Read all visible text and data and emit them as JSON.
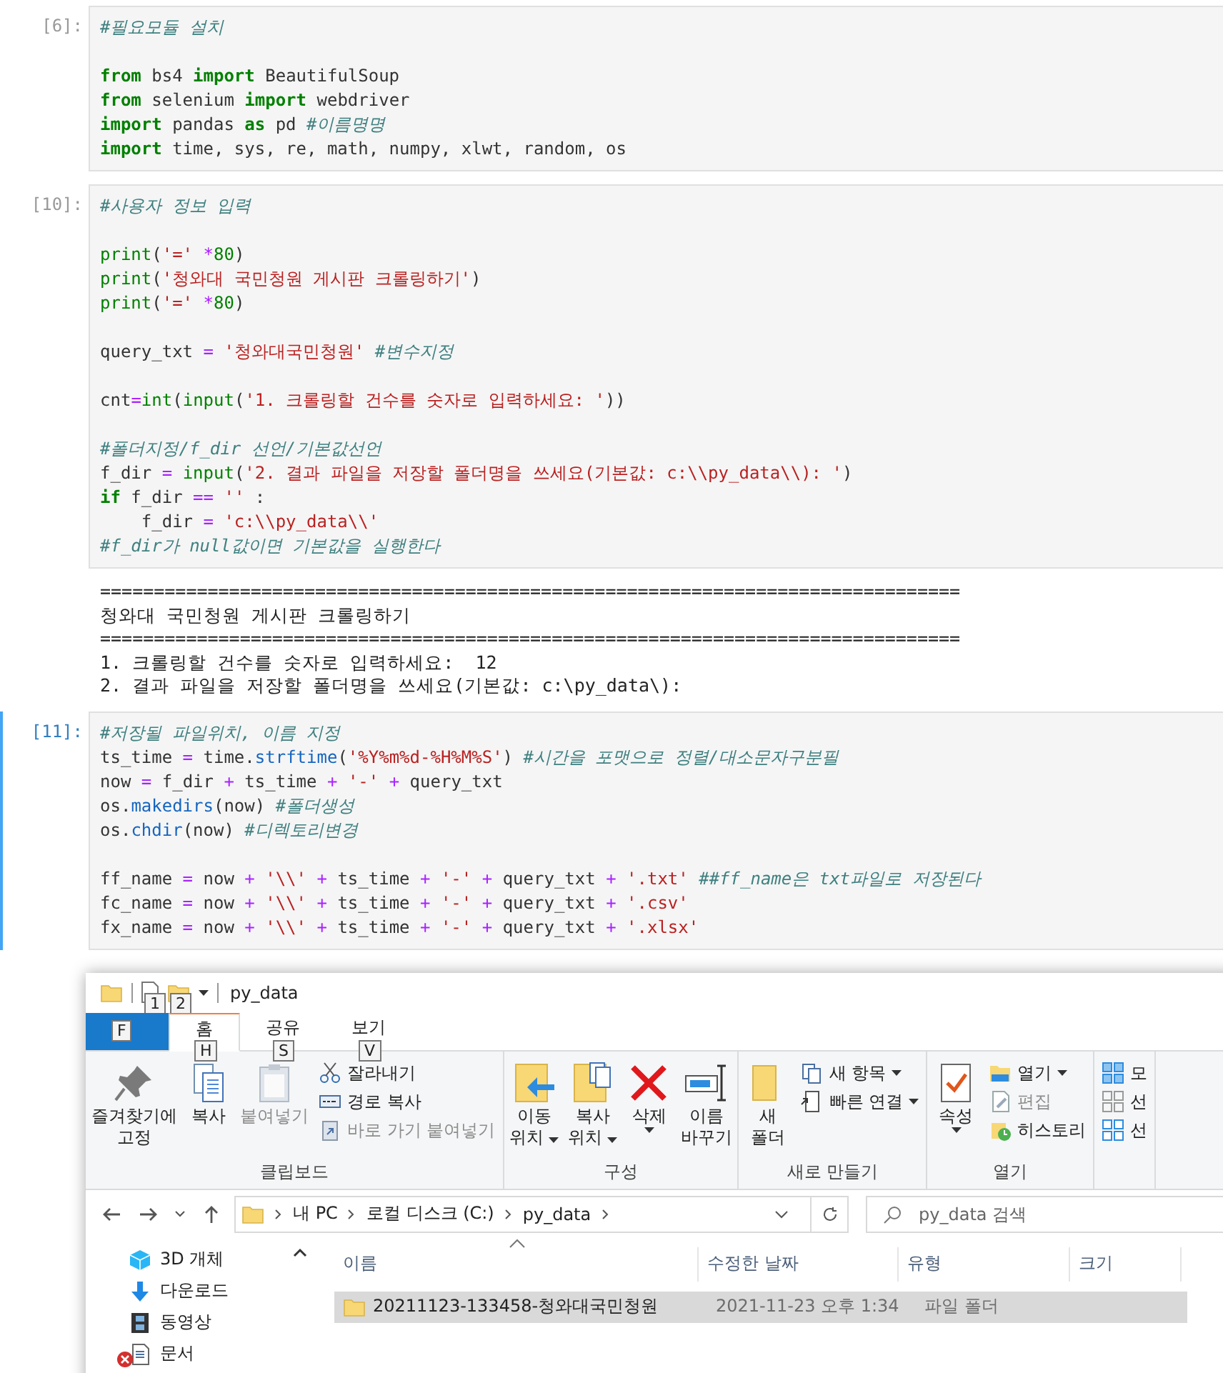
{
  "cells": [
    {
      "prompt": "[6]:",
      "active": false,
      "blocks": [
        [
          [
            {
              "kind": "comment",
              "text": "#필요모듈 설치"
            }
          ]
        ],
        [
          [
            {
              "kind": "keyword",
              "text": "from"
            },
            {
              "kind": "plain",
              "text": " bs4 "
            },
            {
              "kind": "keyword",
              "text": "import"
            },
            {
              "kind": "plain",
              "text": " BeautifulSoup"
            }
          ],
          [
            {
              "kind": "keyword",
              "text": "from"
            },
            {
              "kind": "plain",
              "text": " selenium "
            },
            {
              "kind": "keyword",
              "text": "import"
            },
            {
              "kind": "plain",
              "text": " webdriver"
            }
          ],
          [
            {
              "kind": "keyword",
              "text": "import"
            },
            {
              "kind": "plain",
              "text": " pandas "
            },
            {
              "kind": "keyword",
              "text": "as"
            },
            {
              "kind": "plain",
              "text": " pd "
            },
            {
              "kind": "comment",
              "text": "#이름명명"
            }
          ],
          [
            {
              "kind": "keyword",
              "text": "import"
            },
            {
              "kind": "plain",
              "text": " time, sys, re, math, numpy, xlwt, random, os"
            }
          ]
        ]
      ]
    },
    {
      "prompt": "[10]:",
      "active": false,
      "blocks": [
        [
          [
            {
              "kind": "comment",
              "text": "#사용자 정보 입력"
            }
          ]
        ],
        [
          [
            {
              "kind": "builtin",
              "text": "print"
            },
            {
              "kind": "plain",
              "text": "("
            },
            {
              "kind": "string",
              "text": "'=' "
            },
            {
              "kind": "operator",
              "text": "*"
            },
            {
              "kind": "number",
              "text": "80"
            },
            {
              "kind": "plain",
              "text": ")"
            }
          ],
          [
            {
              "kind": "builtin",
              "text": "print"
            },
            {
              "kind": "plain",
              "text": "("
            },
            {
              "kind": "string",
              "text": "'청와대 국민청원 게시판 크롤링하기'"
            },
            {
              "kind": "plain",
              "text": ")"
            }
          ],
          [
            {
              "kind": "builtin",
              "text": "print"
            },
            {
              "kind": "plain",
              "text": "("
            },
            {
              "kind": "string",
              "text": "'=' "
            },
            {
              "kind": "operator",
              "text": "*"
            },
            {
              "kind": "number",
              "text": "80"
            },
            {
              "kind": "plain",
              "text": ")"
            }
          ]
        ],
        [
          [
            {
              "kind": "plain",
              "text": "query_txt "
            },
            {
              "kind": "operator",
              "text": "= "
            },
            {
              "kind": "string",
              "text": "'청와대국민청원' "
            },
            {
              "kind": "comment",
              "text": "#변수지정"
            }
          ]
        ],
        [
          [
            {
              "kind": "plain",
              "text": "cnt"
            },
            {
              "kind": "operator",
              "text": "="
            },
            {
              "kind": "builtin",
              "text": "int"
            },
            {
              "kind": "plain",
              "text": "("
            },
            {
              "kind": "builtin",
              "text": "input"
            },
            {
              "kind": "plain",
              "text": "("
            },
            {
              "kind": "string",
              "text": "'1. 크롤링할 건수를 숫자로 입력하세요: '"
            },
            {
              "kind": "plain",
              "text": "))"
            }
          ]
        ],
        [
          [
            {
              "kind": "comment",
              "text": "#폴더지정/f_dir 선언/기본값선언"
            }
          ],
          [
            {
              "kind": "plain",
              "text": "f_dir "
            },
            {
              "kind": "operator",
              "text": "= "
            },
            {
              "kind": "builtin",
              "text": "input"
            },
            {
              "kind": "plain",
              "text": "("
            },
            {
              "kind": "string",
              "text": "'2. 결과 파일을 저장할 폴더명을 쓰세요(기본값: c:\\\\py_data\\\\): '"
            },
            {
              "kind": "plain",
              "text": ")"
            }
          ],
          [
            {
              "kind": "keyword",
              "text": "if"
            },
            {
              "kind": "plain",
              "text": " f_dir "
            },
            {
              "kind": "operator",
              "text": "== "
            },
            {
              "kind": "string",
              "text": "''"
            },
            {
              "kind": "plain",
              "text": " :"
            }
          ],
          [
            {
              "kind": "plain",
              "text": "    f_dir "
            },
            {
              "kind": "operator",
              "text": "= "
            },
            {
              "kind": "string",
              "text": "'c:\\\\py_data\\\\'"
            }
          ],
          [
            {
              "kind": "comment",
              "text": "#f_dir가 null값이면 기본값을 실행한다"
            }
          ]
        ]
      ],
      "output": [
        "================================================================================",
        "청와대 국민청원 게시판 크롤링하기",
        "================================================================================",
        "1. 크롤링할 건수를 숫자로 입력하세요:  12",
        "2. 결과 파일을 저장할 폴더명을 쓰세요(기본값: c:\\py_data\\):"
      ]
    },
    {
      "prompt": "[11]:",
      "active": true,
      "blocks": [
        [
          [
            {
              "kind": "comment",
              "text": "#저장될 파일위치, 이름 지정"
            }
          ],
          [
            {
              "kind": "plain",
              "text": "ts_time "
            },
            {
              "kind": "operator",
              "text": "="
            },
            {
              "kind": "plain",
              "text": " time."
            },
            {
              "kind": "method",
              "text": "strftime"
            },
            {
              "kind": "plain",
              "text": "("
            },
            {
              "kind": "string",
              "text": "'%Y%m%d-%H%M%S'"
            },
            {
              "kind": "plain",
              "text": ") "
            },
            {
              "kind": "comment",
              "text": "#시간을 포맷으로 정렬/대소문자구분필"
            }
          ],
          [
            {
              "kind": "plain",
              "text": "now "
            },
            {
              "kind": "operator",
              "text": "="
            },
            {
              "kind": "plain",
              "text": " f_dir "
            },
            {
              "kind": "operator",
              "text": "+"
            },
            {
              "kind": "plain",
              "text": " ts_time "
            },
            {
              "kind": "operator",
              "text": "+ "
            },
            {
              "kind": "string",
              "text": "'-' "
            },
            {
              "kind": "operator",
              "text": "+"
            },
            {
              "kind": "plain",
              "text": " query_txt"
            }
          ],
          [
            {
              "kind": "plain",
              "text": "os."
            },
            {
              "kind": "method",
              "text": "makedirs"
            },
            {
              "kind": "plain",
              "text": "(now) "
            },
            {
              "kind": "comment",
              "text": "#폴더생성"
            }
          ],
          [
            {
              "kind": "plain",
              "text": "os."
            },
            {
              "kind": "method",
              "text": "chdir"
            },
            {
              "kind": "plain",
              "text": "(now) "
            },
            {
              "kind": "comment",
              "text": "#디렉토리변경"
            }
          ]
        ],
        [
          [
            {
              "kind": "plain",
              "text": "ff_name "
            },
            {
              "kind": "operator",
              "text": "="
            },
            {
              "kind": "plain",
              "text": " now "
            },
            {
              "kind": "operator",
              "text": "+ "
            },
            {
              "kind": "string",
              "text": "'\\\\' "
            },
            {
              "kind": "operator",
              "text": "+"
            },
            {
              "kind": "plain",
              "text": " ts_time "
            },
            {
              "kind": "operator",
              "text": "+ "
            },
            {
              "kind": "string",
              "text": "'-' "
            },
            {
              "kind": "operator",
              "text": "+"
            },
            {
              "kind": "plain",
              "text": " query_txt "
            },
            {
              "kind": "operator",
              "text": "+ "
            },
            {
              "kind": "string",
              "text": "'.txt' "
            },
            {
              "kind": "comment",
              "text": "##ff_name은 txt파일로 저장된다"
            }
          ],
          [
            {
              "kind": "plain",
              "text": "fc_name "
            },
            {
              "kind": "operator",
              "text": "="
            },
            {
              "kind": "plain",
              "text": " now "
            },
            {
              "kind": "operator",
              "text": "+ "
            },
            {
              "kind": "string",
              "text": "'\\\\' "
            },
            {
              "kind": "operator",
              "text": "+"
            },
            {
              "kind": "plain",
              "text": " ts_time "
            },
            {
              "kind": "operator",
              "text": "+ "
            },
            {
              "kind": "string",
              "text": "'-' "
            },
            {
              "kind": "operator",
              "text": "+"
            },
            {
              "kind": "plain",
              "text": " query_txt "
            },
            {
              "kind": "operator",
              "text": "+ "
            },
            {
              "kind": "string",
              "text": "'.csv'"
            }
          ],
          [
            {
              "kind": "plain",
              "text": "fx_name "
            },
            {
              "kind": "operator",
              "text": "="
            },
            {
              "kind": "plain",
              "text": " now "
            },
            {
              "kind": "operator",
              "text": "+ "
            },
            {
              "kind": "string",
              "text": "'\\\\' "
            },
            {
              "kind": "operator",
              "text": "+"
            },
            {
              "kind": "plain",
              "text": " ts_time "
            },
            {
              "kind": "operator",
              "text": "+ "
            },
            {
              "kind": "string",
              "text": "'-' "
            },
            {
              "kind": "operator",
              "text": "+"
            },
            {
              "kind": "plain",
              "text": " query_txt "
            },
            {
              "kind": "operator",
              "text": "+ "
            },
            {
              "kind": "string",
              "text": "'.xlsx'"
            }
          ]
        ]
      ]
    }
  ],
  "explorer": {
    "title": "py_data",
    "quick_access_key_tips": [
      "1",
      "2"
    ],
    "tabs": [
      {
        "kind": "file",
        "key_tip": "F",
        "selected": false
      },
      {
        "kind": "normal",
        "label": "홈",
        "key_tip": "H",
        "selected": true
      },
      {
        "kind": "normal",
        "label": "공유",
        "key_tip": "S",
        "selected": false
      },
      {
        "kind": "normal",
        "label": "보기",
        "key_tip": "V",
        "selected": false
      }
    ],
    "ribbon": [
      {
        "title": "클립보드",
        "large": [
          {
            "lines": [
              "즐겨찾기에",
              "고정"
            ],
            "menu": false,
            "disabled": false
          },
          {
            "lines": [
              "복사"
            ],
            "menu": false,
            "disabled": false
          },
          {
            "lines": [
              "붙여넣기"
            ],
            "menu": false,
            "disabled": true
          }
        ],
        "small": [
          {
            "label": "잘라내기",
            "menu": false,
            "disabled": false
          },
          {
            "label": "경로 복사",
            "menu": false,
            "disabled": false
          },
          {
            "label": "바로 가기 붙여넣기",
            "menu": false,
            "disabled": true
          }
        ]
      },
      {
        "title": "구성",
        "large": [
          {
            "lines": [
              "이동",
              "위치"
            ],
            "menu": true,
            "disabled": false
          },
          {
            "lines": [
              "복사",
              "위치"
            ],
            "menu": true,
            "disabled": false
          },
          {
            "lines": [
              "삭제"
            ],
            "menu": true,
            "disabled": false
          },
          {
            "lines": [
              "이름",
              "바꾸기"
            ],
            "menu": false,
            "disabled": false
          }
        ]
      },
      {
        "title": "새로 만들기",
        "large": [
          {
            "lines": [
              "새",
              "폴더"
            ],
            "menu": false,
            "disabled": false
          }
        ],
        "small": [
          {
            "label": "새 항목",
            "menu": true,
            "disabled": false
          },
          {
            "label": "빠른 연결",
            "menu": true,
            "disabled": false
          }
        ]
      },
      {
        "title": "열기",
        "large": [
          {
            "lines": [
              "속성"
            ],
            "menu": true,
            "disabled": false
          }
        ],
        "small": [
          {
            "label": "열기",
            "menu": true,
            "disabled": false
          },
          {
            "label": "편집",
            "menu": false,
            "disabled": true
          },
          {
            "label": "히스토리",
            "menu": false,
            "disabled": false
          }
        ]
      },
      {
        "small": [
          {
            "label": "모",
            "menu": false,
            "disabled": false
          },
          {
            "label": "선",
            "menu": false,
            "disabled": false
          },
          {
            "label": "선",
            "menu": false,
            "disabled": false
          }
        ]
      }
    ],
    "address": [
      "내 PC",
      "로컬 디스크 (C:)",
      "py_data"
    ],
    "search": {
      "placeholder": "py_data 검색"
    },
    "sidebar": [
      {
        "label": "3D 개체",
        "error": false
      },
      {
        "label": "다운로드",
        "error": false
      },
      {
        "label": "동영상",
        "error": false
      },
      {
        "label": "문서",
        "error": true
      }
    ],
    "columns": [
      {
        "label": "이름",
        "sorted": true
      },
      {
        "label": "수정한 날짜",
        "sorted": false
      },
      {
        "label": "유형",
        "sorted": false
      },
      {
        "label": "크기",
        "sorted": false
      }
    ],
    "rows": [
      {
        "cells": [
          "20211123-133458-청와대국민청원",
          "2021-11-23 오후 1:34",
          "파일 폴더"
        ],
        "selected": true
      }
    ]
  }
}
